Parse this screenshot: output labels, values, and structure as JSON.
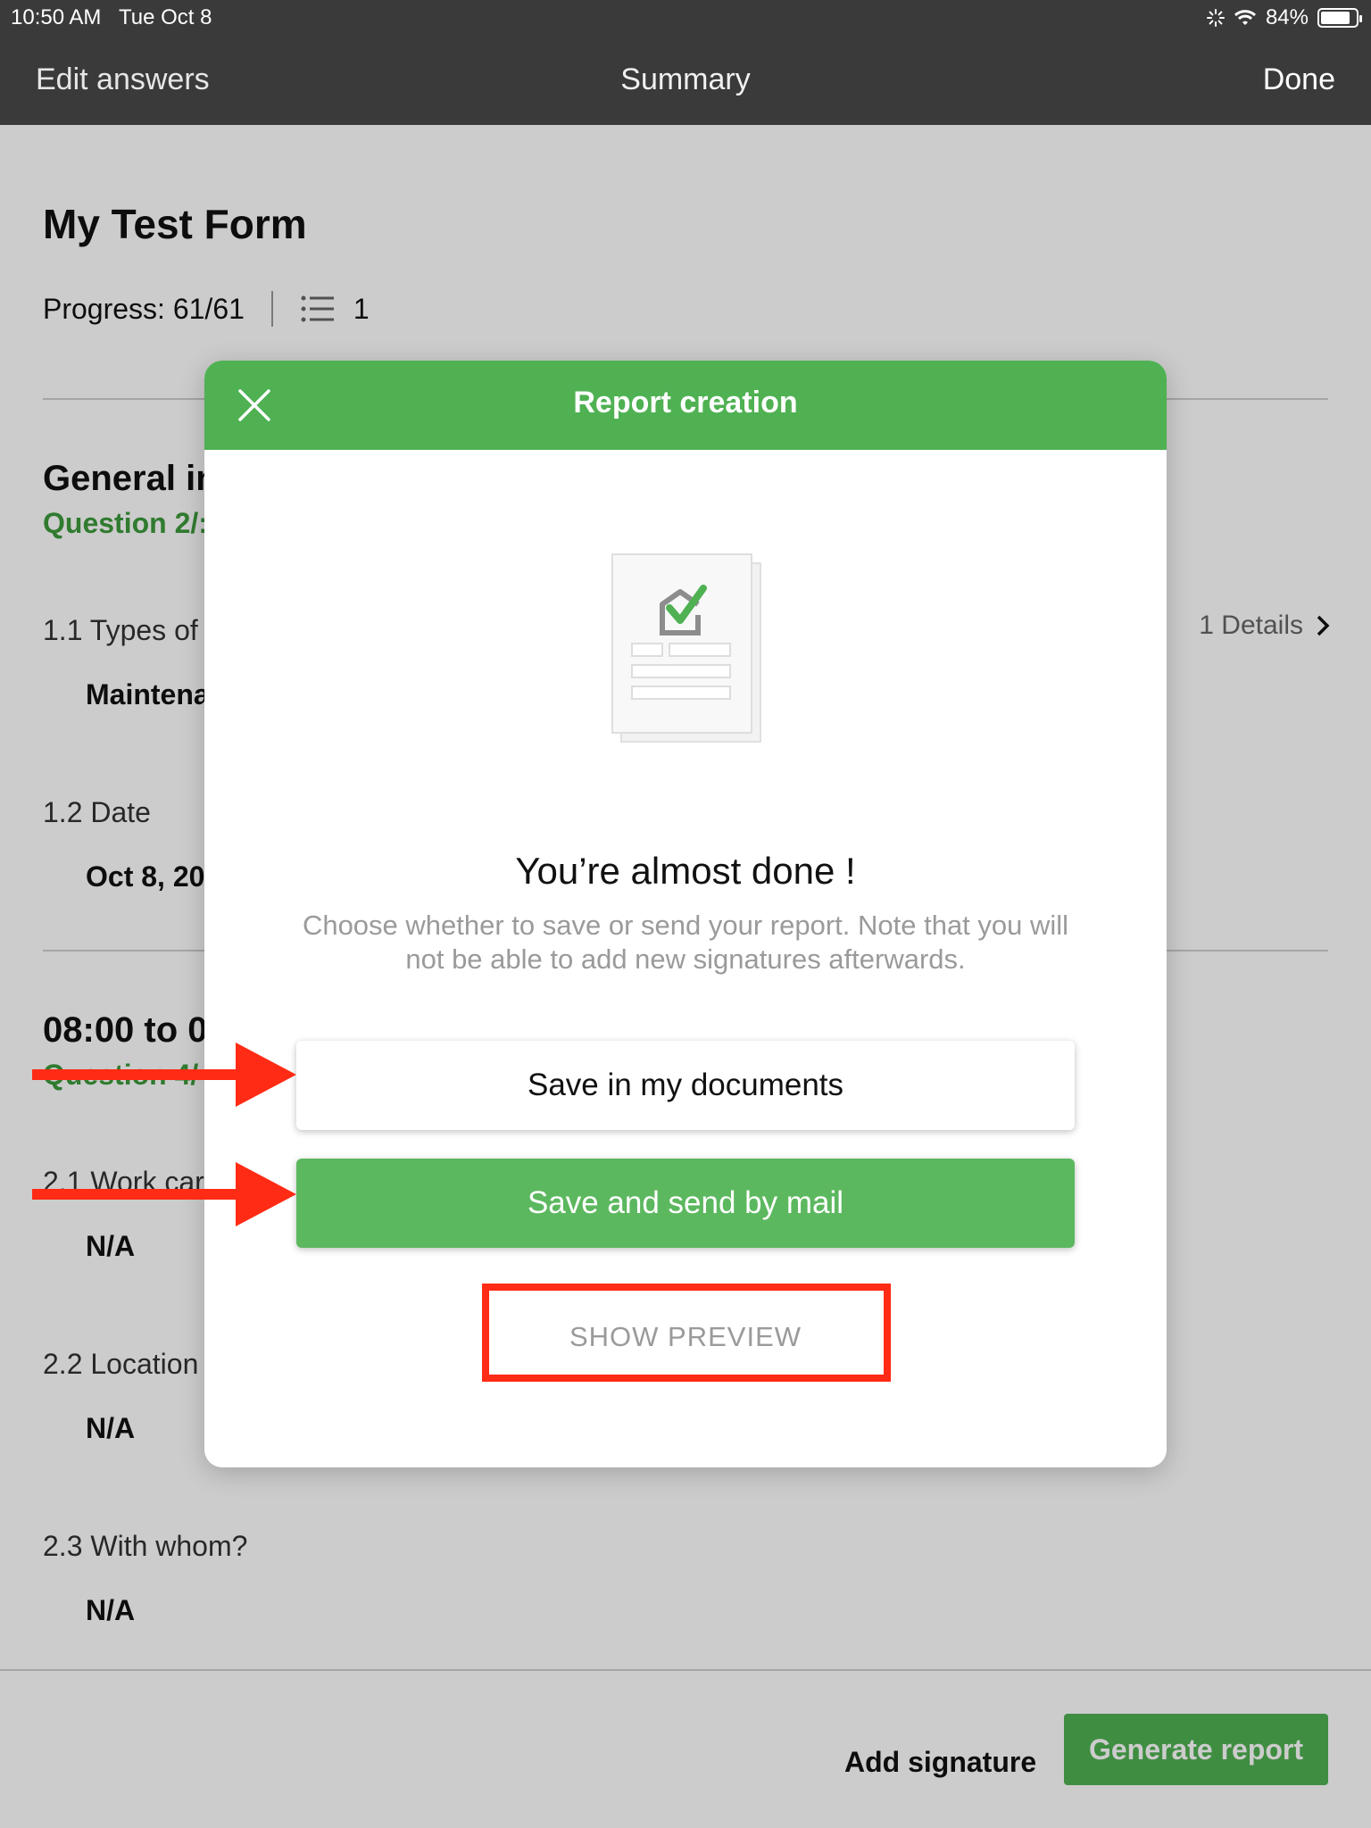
{
  "status": {
    "time": "10:50 AM",
    "date": "Tue Oct 8",
    "battery": "84%",
    "battery_level": 0.84
  },
  "nav": {
    "left": "Edit answers",
    "title": "Summary",
    "right": "Done"
  },
  "form": {
    "title": "My Test Form",
    "progress": "Progress: 61/61",
    "list_count": "1"
  },
  "section1": {
    "title": "General in",
    "subtitle": "Question 2/:",
    "q1_label": "1.1 Types of v",
    "q1_answer": "Maintena",
    "details": "1 Details",
    "q2_label": "1.2 Date",
    "q2_answer": "Oct 8, 20"
  },
  "section2": {
    "title": "08:00 to 0",
    "subtitle": "Question 4/",
    "q1_label": "2.1 Work car",
    "q1_answer": "N/A",
    "q2_label": "2.2 Location",
    "q2_answer": "N/A",
    "q3_label": "2.3 With whom?",
    "q3_answer": "N/A"
  },
  "bottom": {
    "add_signature": "Add signature",
    "generate_report": "Generate report"
  },
  "modal": {
    "title": "Report creation",
    "heading": "You’re almost done !",
    "body": "Choose whether to save or send your report. Note that you will not be able to add new signatures afterwards.",
    "save_button": "Save in my documents",
    "send_button": "Save and send by mail",
    "preview": "SHOW PREVIEW"
  },
  "colors": {
    "green": "#4fb152",
    "annotation_red": "#ff2b14",
    "topbar": "#3a3a3a"
  }
}
